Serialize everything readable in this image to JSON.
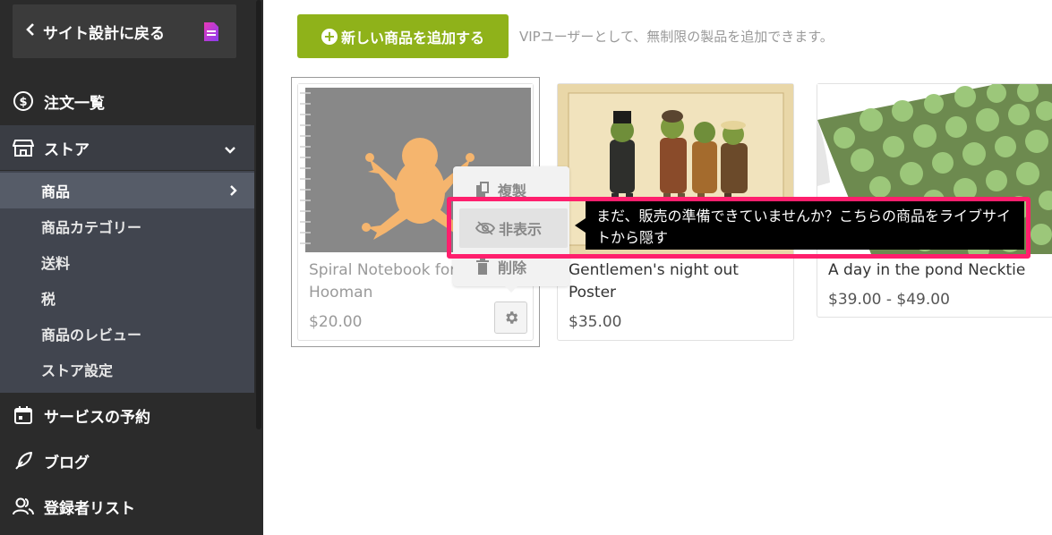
{
  "sidebar": {
    "back_label": "サイト設計に戻る",
    "items": [
      {
        "label": "注文一覧",
        "icon": "dollar-circle-icon"
      },
      {
        "label": "ストア",
        "icon": "store-icon"
      },
      {
        "label": "サービスの予約",
        "icon": "calendar-icon"
      },
      {
        "label": "ブログ",
        "icon": "feather-pen-icon"
      },
      {
        "label": "登録者リスト",
        "icon": "users-icon"
      }
    ],
    "store_subitems": [
      {
        "label": "商品",
        "active": true
      },
      {
        "label": "商品カテゴリー"
      },
      {
        "label": "送料"
      },
      {
        "label": "税"
      },
      {
        "label": "商品のレビュー"
      },
      {
        "label": "ストア設定"
      }
    ]
  },
  "toolbar": {
    "add_button_label": "新しい商品を追加する",
    "vip_note": "VIPユーザーとして、無制限の製品を追加できます。"
  },
  "products": [
    {
      "title_line1": "Spiral Notebook for",
      "title_line2": "Hooman",
      "price": "$20.00",
      "hidden_state": "dim"
    },
    {
      "title_line1": "Gentlemen's night out",
      "title_line2": "Poster",
      "price": "$35.00"
    },
    {
      "title_line1": "A day in the pond Necktie",
      "title_line2": "",
      "price": "$39.00 - $49.00"
    }
  ],
  "context_menu": {
    "duplicate_label": "複製",
    "hide_label": "非表示",
    "delete_label": "削除"
  },
  "tooltip": {
    "text": "まだ、販売の準備できていませんか？こちらの商品をライブサイトから隠す"
  },
  "colors": {
    "sidebar_bg": "#2b2b2b",
    "accent_green": "#8fb21a",
    "highlight_pink": "#ff1f6d"
  }
}
